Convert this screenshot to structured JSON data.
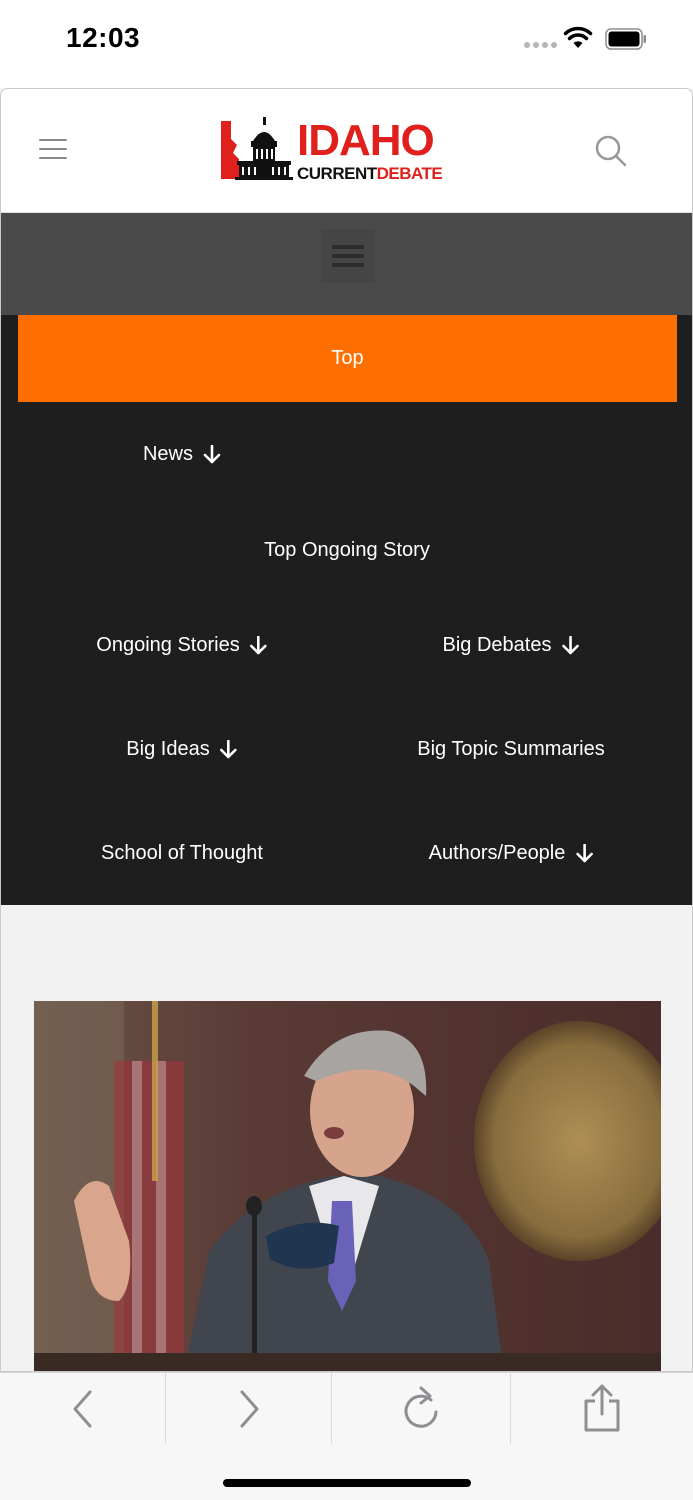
{
  "status_bar": {
    "time": "12:03"
  },
  "header": {
    "logo_word_main": "IDAHO",
    "logo_word_current": "CURRENT",
    "logo_word_debate": "DEBATE"
  },
  "nav": {
    "top_label": "Top",
    "items": [
      {
        "label": "News",
        "has_submenu": true
      },
      {
        "label": "Top Ongoing Story",
        "has_submenu": false
      },
      {
        "label": "Ongoing Stories",
        "has_submenu": true
      },
      {
        "label": "Big Debates",
        "has_submenu": true
      },
      {
        "label": "Big Ideas",
        "has_submenu": true
      },
      {
        "label": "Big Topic Summaries",
        "has_submenu": false
      },
      {
        "label": "School of Thought",
        "has_submenu": false
      },
      {
        "label": "Authors/People",
        "has_submenu": true
      }
    ]
  },
  "colors": {
    "accent": "#ff6f00",
    "nav_background": "#1e1e1e",
    "menu_bar": "#4a4a4a",
    "brand_red": "#e0201c"
  },
  "icons": {
    "menu": "hamburger-icon",
    "search": "search-icon",
    "submenu": "arrow-down-icon",
    "back": "chevron-left-icon",
    "forward": "chevron-right-icon",
    "reload": "reload-icon",
    "share": "share-icon"
  }
}
